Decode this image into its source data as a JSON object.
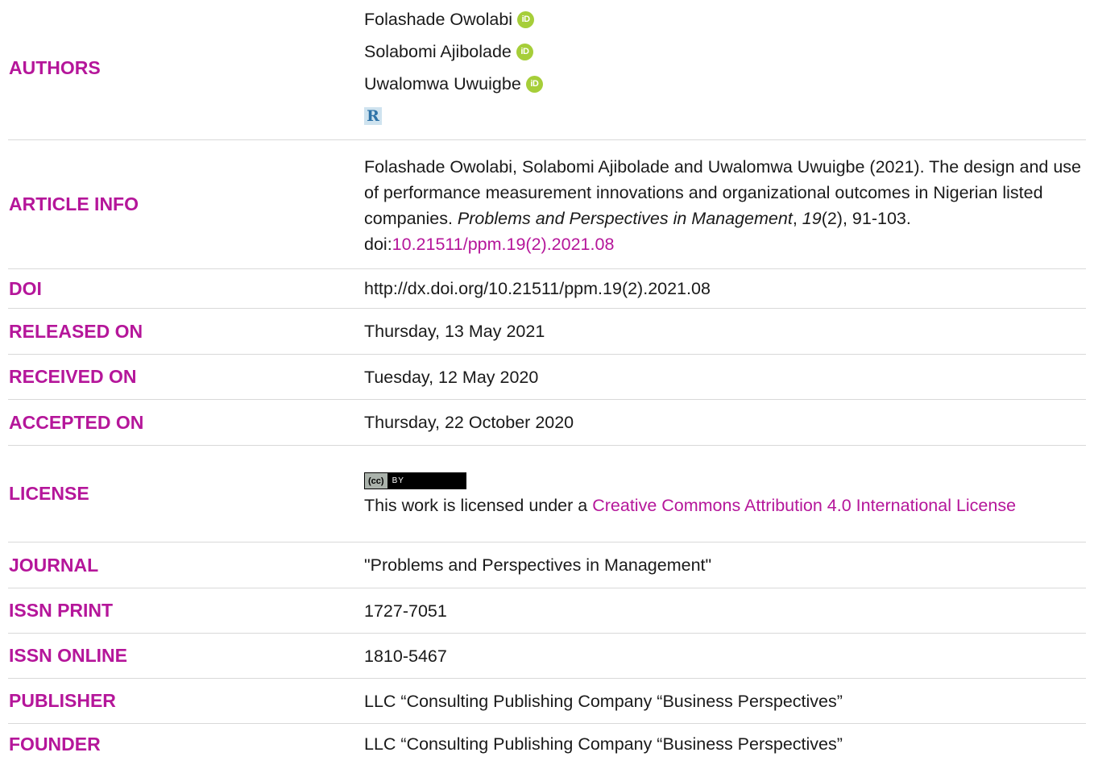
{
  "authors": {
    "label": "AUTHORS",
    "names": [
      "Folashade Owolabi",
      "Solabomi Ajibolade",
      "Uwalomwa Uwuigbe"
    ],
    "orcid_text": "iD",
    "rid_text": "R"
  },
  "article_info": {
    "label": "ARTICLE INFO",
    "text_before": "Folashade Owolabi, Solabomi Ajibolade and Uwalomwa Uwuigbe (2021). The design and use of performance measurement innovations and organizational outcomes in Nigerian listed companies. ",
    "journal": "Problems and Perspectives in Management",
    "comma": ", ",
    "volume": "19",
    "issue_pages": "(2), 91-103. doi:",
    "doi_link": "10.21511/ppm.19(2).2021.08"
  },
  "doi": {
    "label": "DOI",
    "value": "http://dx.doi.org/10.21511/ppm.19(2).2021.08"
  },
  "released": {
    "label": "RELEASED ON",
    "value": "Thursday, 13 May 2021"
  },
  "received": {
    "label": "RECEIVED ON",
    "value": "Tuesday, 12 May 2020"
  },
  "accepted": {
    "label": "ACCEPTED ON",
    "value": "Thursday, 22 October 2020"
  },
  "license": {
    "label": "LICENSE",
    "badge_cc": "(cc)",
    "badge_by": "BY",
    "text_before": "This work is licensed under a ",
    "link": "Creative Commons Attribution 4.0 International License"
  },
  "journal": {
    "label": "JOURNAL",
    "value": "\"Problems and Perspectives in Management\""
  },
  "issn_print": {
    "label": "ISSN PRINT",
    "value": "1727-7051"
  },
  "issn_online": {
    "label": "ISSN ONLINE",
    "value": "1810-5467"
  },
  "publisher": {
    "label": "PUBLISHER",
    "value": "LLC “Consulting Publishing Company “Business Perspectives”"
  },
  "founder": {
    "label": "FOUNDER",
    "value": "LLC “Consulting Publishing Company “Business Perspectives”"
  },
  "colors": {
    "label": "#b5169a",
    "orcid": "#a6ce39",
    "divider": "#d9d9d9"
  }
}
